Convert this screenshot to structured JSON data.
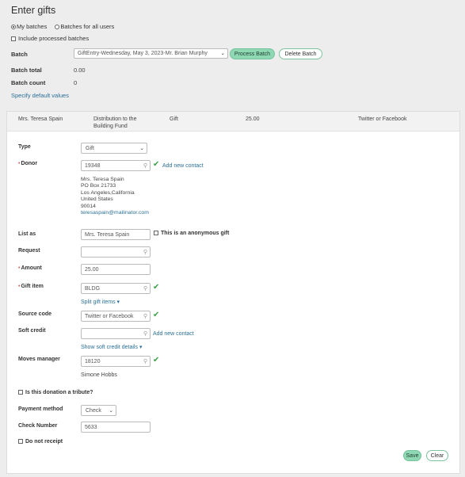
{
  "page": {
    "title": "Enter gifts"
  },
  "filters": {
    "my_batches": "My batches",
    "batches_all": "Batches for all users",
    "include_processed": "Include processed batches"
  },
  "batch": {
    "label": "Batch",
    "selected": "GiftEntry-Wednesday, May 3, 2023-Mr. Brian Murphy",
    "process_label": "Process Batch",
    "delete_label": "Delete Batch",
    "total_label": "Batch total",
    "total_value": "0.00",
    "count_label": "Batch count",
    "count_value": "0",
    "defaults_link": "Specify default values"
  },
  "summary_row": {
    "donor": "Mrs. Teresa Spain",
    "distribution": "Distribution to the Building Fund",
    "type": "Gift",
    "amount": "25.00",
    "source": "Twitter or Facebook"
  },
  "form": {
    "type_label": "Type",
    "type_value": "Gift",
    "donor_label": "Donor",
    "donor_value": "19348",
    "add_contact": "Add new contact",
    "address": {
      "name": "Mrs. Teresa Spain",
      "line1": "PO Box 21733",
      "line2": "Los Angeles,California",
      "country": "United States",
      "zip": "90014",
      "email": "teresaspain@mailinator.com"
    },
    "list_as_label": "List as",
    "list_as_value": "Mrs. Teresa Spain",
    "anonymous_label": "This is an anonymous gift",
    "request_label": "Request",
    "request_value": "",
    "amount_label": "Amount",
    "amount_value": "25.00",
    "gift_item_label": "Gift item",
    "gift_item_value": "BLDG",
    "split_link": "Split gift items",
    "source_label": "Source code",
    "source_value": "Twitter or Facebook",
    "soft_credit_label": "Soft credit",
    "soft_credit_value": "",
    "soft_add_contact": "Add new contact",
    "soft_details_link": "Show soft credit details",
    "moves_label": "Moves manager",
    "moves_value": "18120",
    "moves_name": "Simone Hobbs",
    "tribute_label": "Is this donation a tribute?",
    "payment_label": "Payment method",
    "payment_value": "Check",
    "check_label": "Check Number",
    "check_value": "5633",
    "no_receipt_label": "Do not receipt",
    "save_label": "Save",
    "clear_label": "Clear"
  },
  "colors": {
    "accent": "#8fd8b4",
    "link": "#2a6f97",
    "check": "#3aa04a",
    "required": "#d9534f"
  }
}
